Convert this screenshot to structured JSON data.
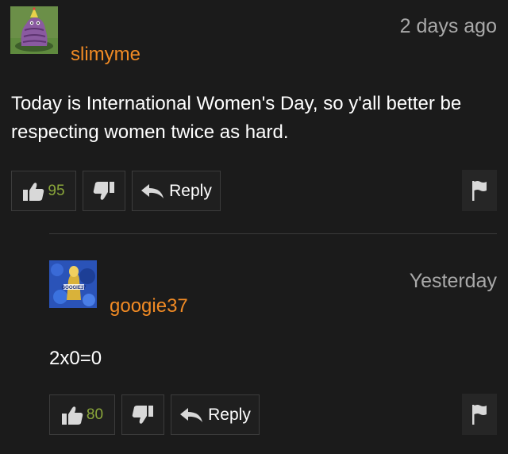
{
  "comments": [
    {
      "username": "slimyme",
      "timestamp": "2 days ago",
      "text": "Today is International Women's Day, so y'all better be respecting women twice as hard.",
      "likes": "95",
      "reply_label": "Reply"
    },
    {
      "username": "googie37",
      "timestamp": "Yesterday",
      "text": "2x0=0",
      "likes": "80",
      "reply_label": "Reply",
      "avatar_text": "GOOGIE37"
    }
  ],
  "icons": {
    "thumbs_up": "thumbs-up-icon",
    "thumbs_down": "thumbs-down-icon",
    "reply": "reply-arrow-icon",
    "flag": "flag-icon"
  },
  "colors": {
    "background": "#1b1b1b",
    "username": "#f08a24",
    "timestamp": "#a9a9a9",
    "like_count": "#8aa63a",
    "button_border": "#3c3c3c"
  }
}
